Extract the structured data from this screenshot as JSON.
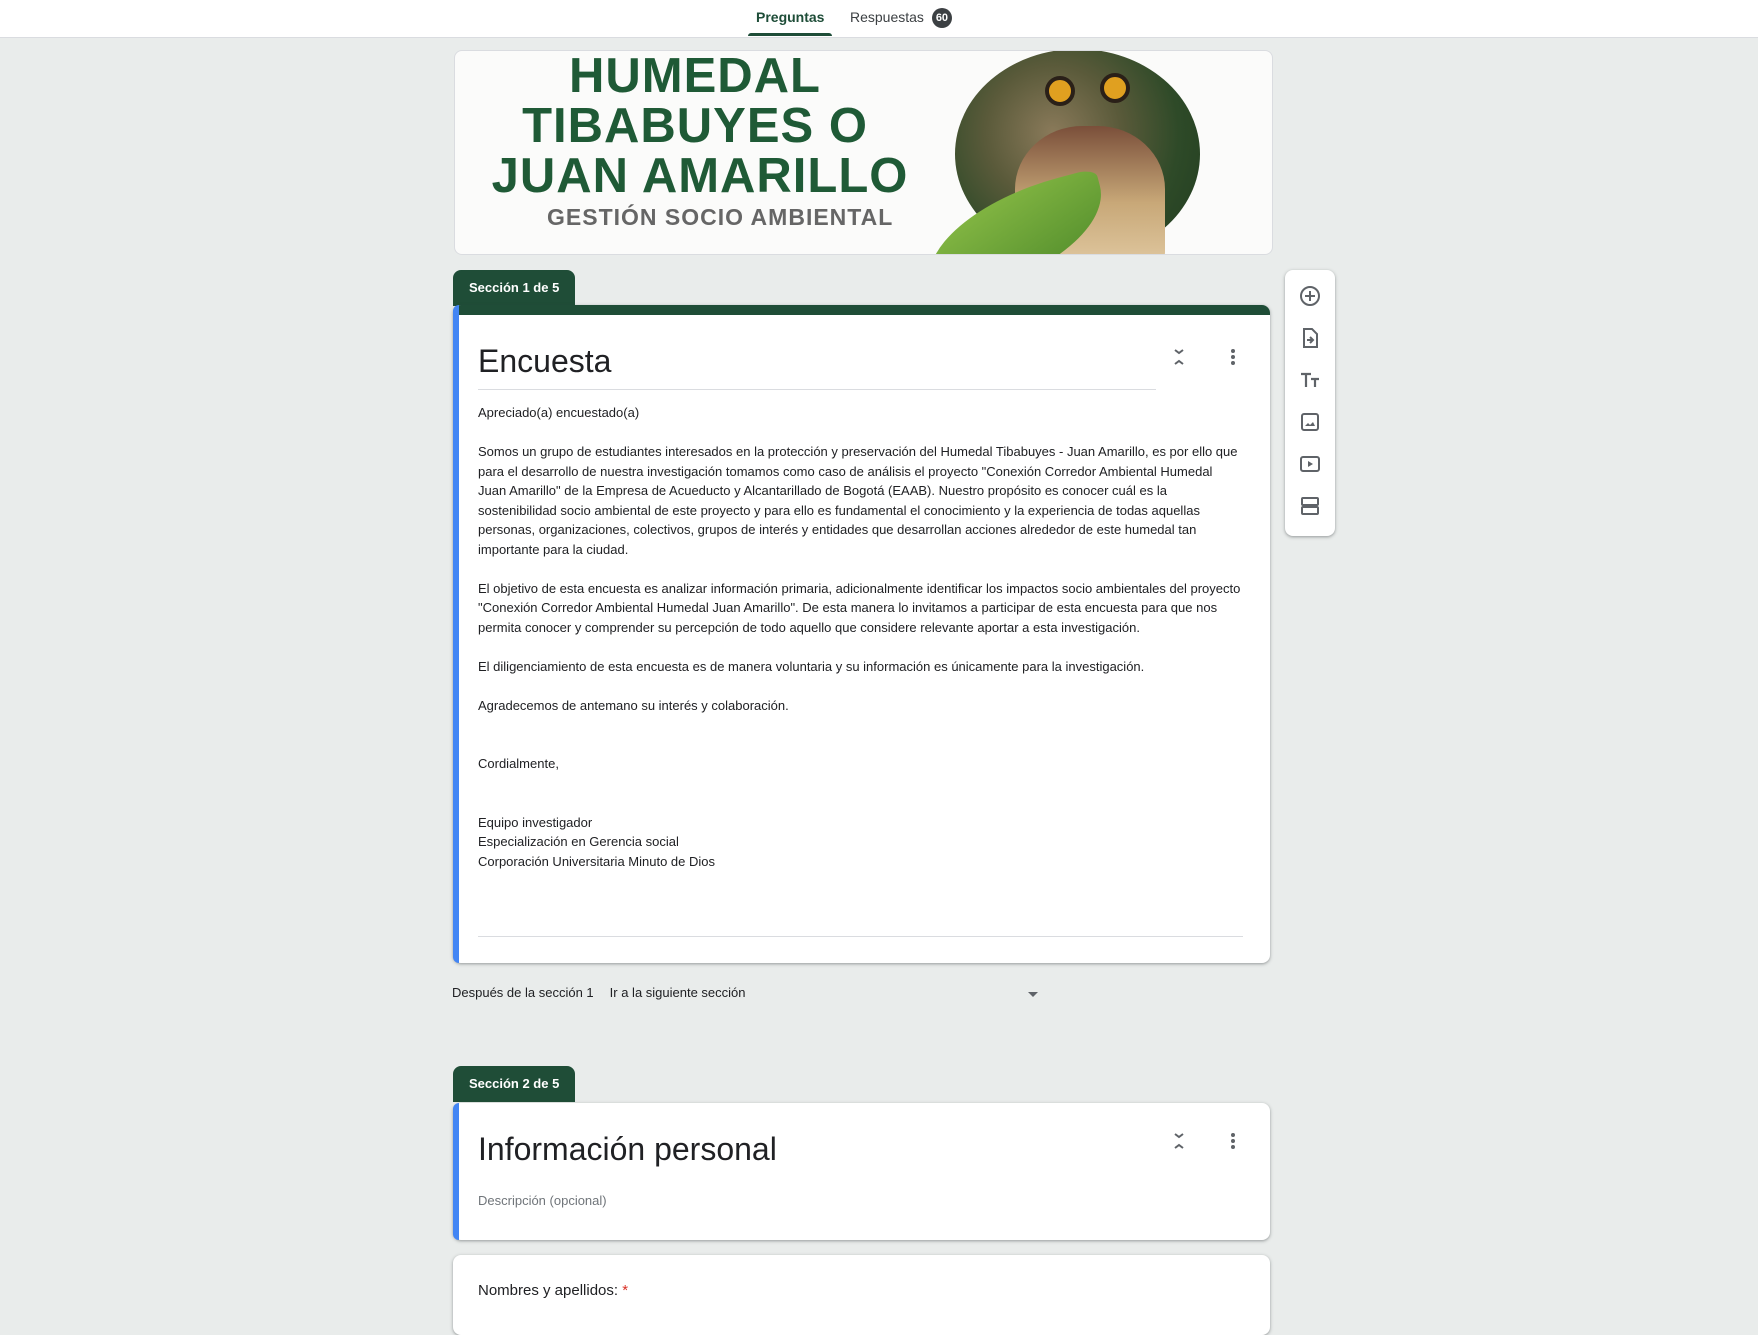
{
  "tabs": [
    {
      "label": "Preguntas",
      "active": true
    },
    {
      "label": "Respuestas",
      "badge": "60"
    }
  ],
  "header": {
    "title_lines": [
      "HUMEDAL",
      "TIBABUYES O",
      "JUAN AMARILLO"
    ],
    "subtitle": "GESTIÓN SOCIO AMBIENTAL"
  },
  "colors": {
    "theme": "#1f4d37",
    "active_card_bar": "#4285f4",
    "background": "#e9eceb"
  },
  "section1": {
    "tab": "Sección 1 de 5",
    "title": "Encuesta",
    "description": [
      "Apreciado(a) encuestado(a)",
      "",
      "Somos un grupo de estudiantes interesados en la protección y preservación del Humedal Tibabuyes - Juan Amarillo, es por ello que para el desarrollo de nuestra investigación tomamos como caso de análisis el proyecto \"Conexión Corredor Ambiental Humedal Juan Amarillo\" de la Empresa de Acueducto y Alcantarillado de Bogotá (EAAB). Nuestro propósito es conocer cuál es la sostenibilidad socio ambiental de este proyecto y para ello es fundamental el conocimiento y la experiencia de todas aquellas personas, organizaciones, colectivos, grupos de interés y entidades que desarrollan acciones alrededor de este humedal tan importante para la ciudad.",
      "",
      "El objetivo de esta encuesta es analizar información primaria, adicionalmente identificar los impactos socio ambientales del proyecto \"Conexión Corredor Ambiental Humedal Juan Amarillo\". De esta manera lo invitamos a participar de esta encuesta para que nos permita conocer y comprender su percepción de todo aquello que considere relevante aportar a esta investigación.",
      "",
      "El diligenciamiento de esta encuesta es de manera voluntaria y su información es únicamente para la investigación.",
      "",
      "Agradecemos de antemano su interés y colaboración.",
      "",
      "",
      "Cordialmente,",
      "",
      "",
      "Equipo investigador",
      "Especialización en Gerencia social",
      "Corporación Universitaria Minuto de Dios"
    ]
  },
  "after_section": {
    "label": "Después de la sección 1",
    "value": "Ir a la siguiente sección"
  },
  "section2": {
    "tab": "Sección 2 de 5",
    "title": "Información personal",
    "description_placeholder": "Descripción (opcional)"
  },
  "question1": {
    "label": "Nombres y apellidos:",
    "required_mark": "*"
  },
  "sidebar_icons": [
    "add-question-icon",
    "import-questions-icon",
    "add-title-icon",
    "add-image-icon",
    "add-video-icon",
    "add-section-icon"
  ]
}
